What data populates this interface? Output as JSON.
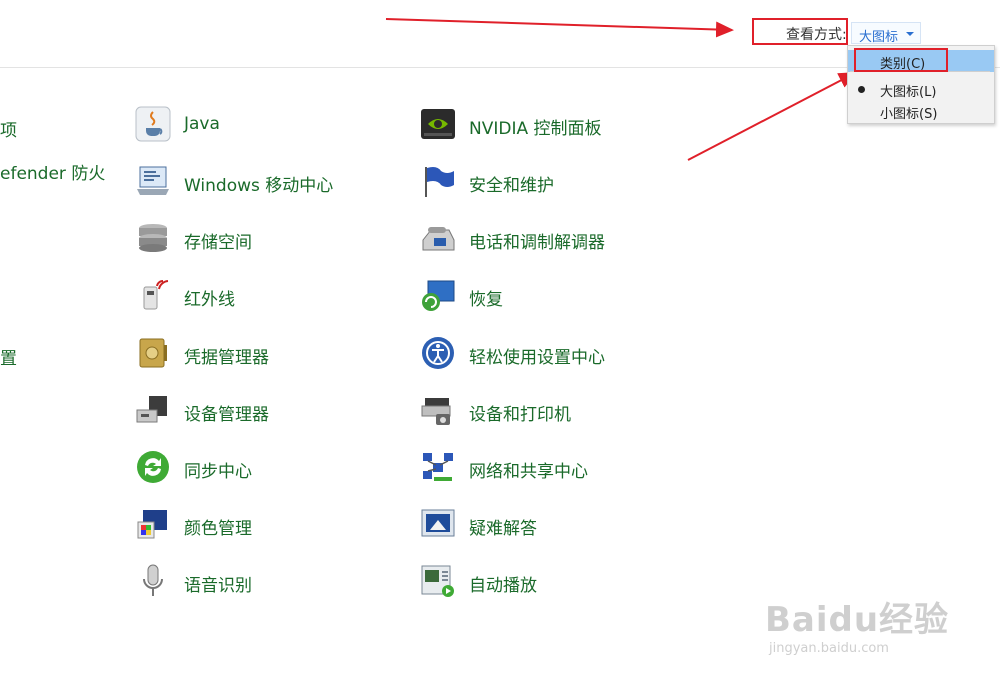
{
  "view": {
    "label": "查看方式:",
    "current": "大图标"
  },
  "menu": {
    "items": [
      {
        "label": "类别(C)",
        "selected": true,
        "checked": false
      },
      {
        "label": "大图标(L)",
        "selected": false,
        "checked": true
      },
      {
        "label": "小图标(S)",
        "selected": false,
        "checked": false
      }
    ]
  },
  "left_fragments": [
    "项",
    "efender 防火",
    "置"
  ],
  "column1": [
    {
      "label": "Java",
      "icon": "java-icon"
    },
    {
      "label": "Windows 移动中心",
      "icon": "mobility-center-icon"
    },
    {
      "label": "存储空间",
      "icon": "storage-spaces-icon"
    },
    {
      "label": "红外线",
      "icon": "infrared-icon"
    },
    {
      "label": "凭据管理器",
      "icon": "credential-manager-icon"
    },
    {
      "label": "设备管理器",
      "icon": "device-manager-icon"
    },
    {
      "label": "同步中心",
      "icon": "sync-center-icon"
    },
    {
      "label": "颜色管理",
      "icon": "color-management-icon"
    },
    {
      "label": "语音识别",
      "icon": "speech-recognition-icon"
    }
  ],
  "column2": [
    {
      "label": "NVIDIA 控制面板",
      "icon": "nvidia-icon"
    },
    {
      "label": "安全和维护",
      "icon": "security-maintenance-icon"
    },
    {
      "label": "电话和调制解调器",
      "icon": "phone-modem-icon"
    },
    {
      "label": "恢复",
      "icon": "recovery-icon"
    },
    {
      "label": "轻松使用设置中心",
      "icon": "ease-of-access-icon"
    },
    {
      "label": "设备和打印机",
      "icon": "devices-printers-icon"
    },
    {
      "label": "网络和共享中心",
      "icon": "network-sharing-icon"
    },
    {
      "label": "疑难解答",
      "icon": "troubleshooting-icon"
    },
    {
      "label": "自动播放",
      "icon": "autoplay-icon"
    }
  ],
  "watermark": {
    "brand": "Baidu经验",
    "url": "jingyan.baidu.com"
  },
  "colors": {
    "link": "#1a6a2a",
    "annotation": "#e0202a",
    "menu_selected": "#99c9f3"
  }
}
